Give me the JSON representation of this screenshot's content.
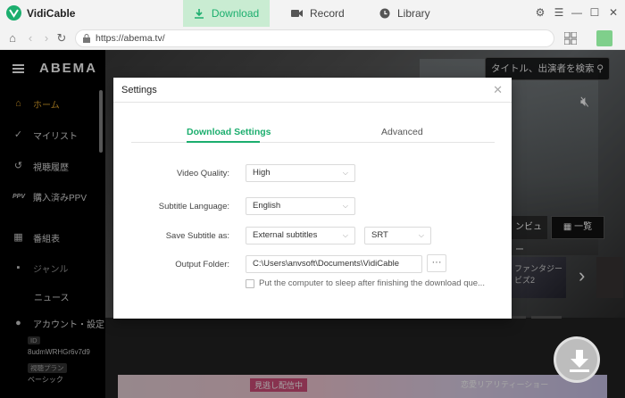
{
  "app": {
    "title": "VidiCable"
  },
  "tabs": {
    "download": "Download",
    "record": "Record",
    "library": "Library"
  },
  "browser": {
    "url": "https://abema.tv/"
  },
  "abema": {
    "logo": "ABEMA",
    "sidebar": [
      {
        "label": "ホーム",
        "icon": "home-icon"
      },
      {
        "label": "マイリスト",
        "icon": "check-icon"
      },
      {
        "label": "視聴履歴",
        "icon": "history-icon"
      },
      {
        "label": "購入済みPPV",
        "icon": "ppv-icon"
      },
      {
        "label": "番組表",
        "icon": "calendar-icon"
      },
      {
        "label": "ジャンル",
        "icon": "grid-icon"
      },
      {
        "label": "ニュース",
        "icon": "news-icon"
      },
      {
        "label": "アカウント・設定",
        "icon": "account-icon"
      }
    ],
    "account_id_badge": "ID",
    "account_id": "8udmWRHGr6v7d9",
    "plan_badge": "視聴プラン",
    "plan": "ベーシック",
    "search_placeholder": "タイトル、出演者を検索",
    "preview_label": "ンビュー",
    "list_label": "一覧",
    "poster_text": "ファンタジー ビズ2",
    "banner_left": "見逃し配信中",
    "banner_right": "恋愛リアリティーショー"
  },
  "settings": {
    "title": "Settings",
    "tab_download": "Download Settings",
    "tab_advanced": "Advanced",
    "video_quality_label": "Video Quality:",
    "video_quality_value": "High",
    "subtitle_language_label": "Subtitle Language:",
    "subtitle_language_value": "English",
    "save_subtitle_label": "Save Subtitle as:",
    "save_subtitle_value": "External subtitles",
    "subtitle_format_value": "SRT",
    "output_folder_label": "Output Folder:",
    "output_folder_value": "C:\\Users\\anvsoft\\Documents\\VidiCable",
    "browse_label": "···",
    "sleep_label": "Put the computer to sleep after finishing the download que..."
  }
}
